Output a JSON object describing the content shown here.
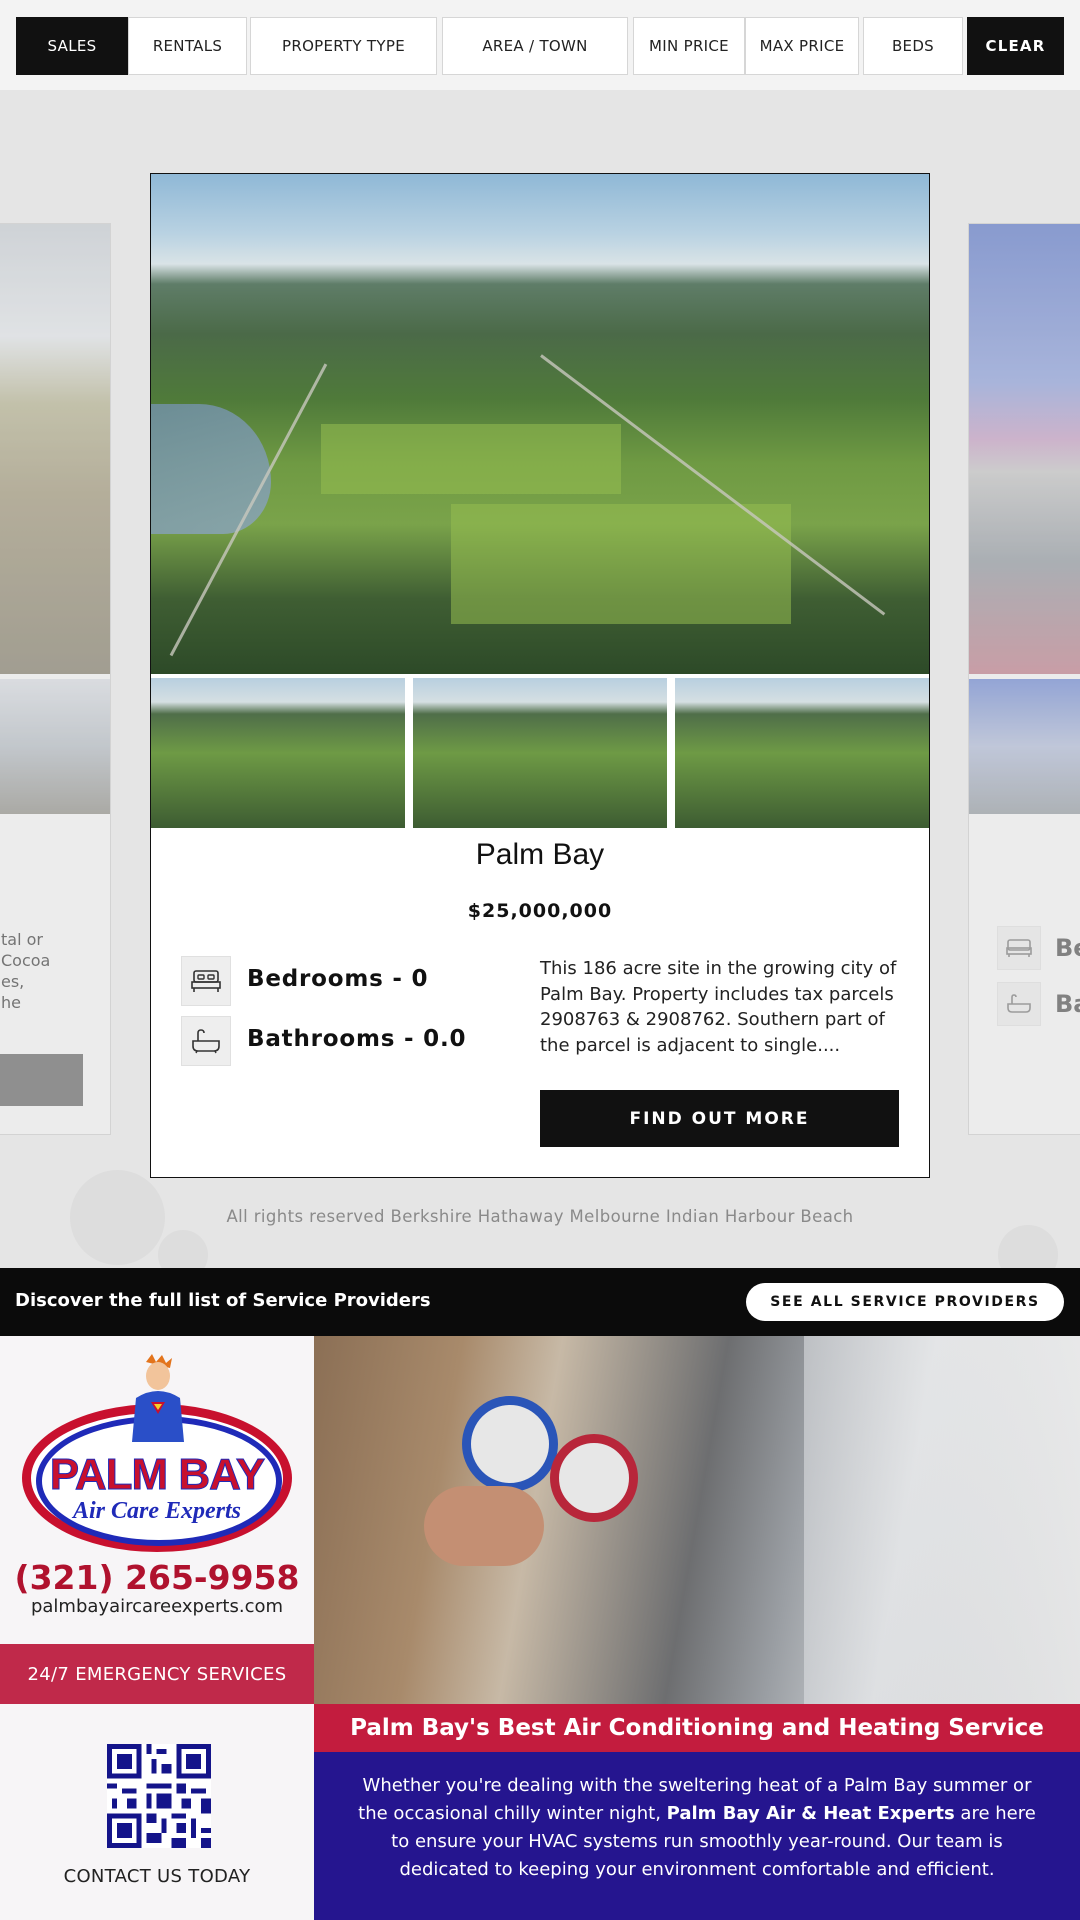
{
  "filters": {
    "sales": "SALES",
    "rentals": "RENTALS",
    "property_type": "PROPERTY TYPE",
    "area_town": "AREA / TOWN",
    "min_price": "MIN PRICE",
    "max_price": "MAX PRICE",
    "beds": "BEDS",
    "clear": "CLEAR"
  },
  "left_card": {
    "text_lines": [
      "tal or",
      "Cocoa",
      "es,",
      "he"
    ]
  },
  "right_card": {
    "bed_label": "Be",
    "bath_label": "Ba"
  },
  "listing": {
    "title": "Palm Bay",
    "price": "$25,000,000",
    "bedrooms": "Bedrooms - 0",
    "bathrooms": "Bathrooms - 0.0",
    "description": "This 186 acre site in the growing city of Palm Bay. Property includes tax parcels 2908763 & 2908762. Southern part of the parcel is adjacent to single....",
    "button": "FIND OUT MORE"
  },
  "footer": {
    "rights": "All rights reserved Berkshire Hathaway Melbourne Indian Harbour Beach"
  },
  "service_bar": {
    "text": "Discover the full list of Service Providers",
    "button": "SEE ALL SERVICE PROVIDERS"
  },
  "ad": {
    "brand_main": "PALM BAY",
    "brand_sub": "Air Care Experts",
    "phone": "(321) 265-9958",
    "website": "palmbayaircareexperts.com",
    "emergency": "24/7 EMERGENCY SERVICES",
    "contact": "CONTACT US TODAY",
    "headline": "Palm Bay's Best Air Conditioning and Heating Service",
    "body_start": "Whether you're dealing with the sweltering heat of a Palm Bay summer or the occasional chilly winter night, ",
    "body_bold": "Palm Bay Air & Heat Experts",
    "body_end": " are here to ensure your HVAC systems run smoothly year-round. Our team is dedicated to keeping your environment comfortable and efficient.",
    "colors": {
      "red": "#c31c3e",
      "blue": "#25158f"
    }
  },
  "icons": [
    "bed-icon",
    "bathtub-icon",
    "qr-code"
  ]
}
